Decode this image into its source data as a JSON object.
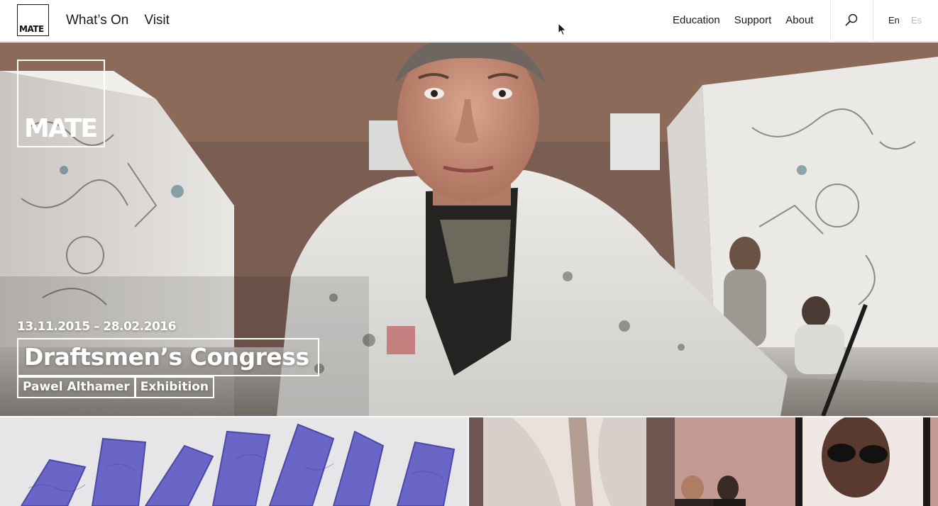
{
  "brand": {
    "logo_text": "MATE"
  },
  "nav": {
    "primary": [
      "What’s On",
      "Visit"
    ],
    "secondary": [
      "Education",
      "Support",
      "About"
    ],
    "search_icon": "search-icon",
    "languages": {
      "active": "En",
      "inactive": "Es"
    }
  },
  "hero": {
    "logo_text": "MATE",
    "date_range": "13.11.2015 – 28.02.2016",
    "title": "Draftsmen’s Congress",
    "tags": [
      "Pawel Althamer",
      "Exhibition"
    ]
  },
  "colors": {
    "text": "#1a1a1a",
    "inactive_lang": "#bdbdbd",
    "overlay_text": "#ffffff",
    "tile_left_bg": "#e6e5e8",
    "tile_left_accent": "#6a66c8",
    "tile_right_bg": "#a68a82"
  }
}
